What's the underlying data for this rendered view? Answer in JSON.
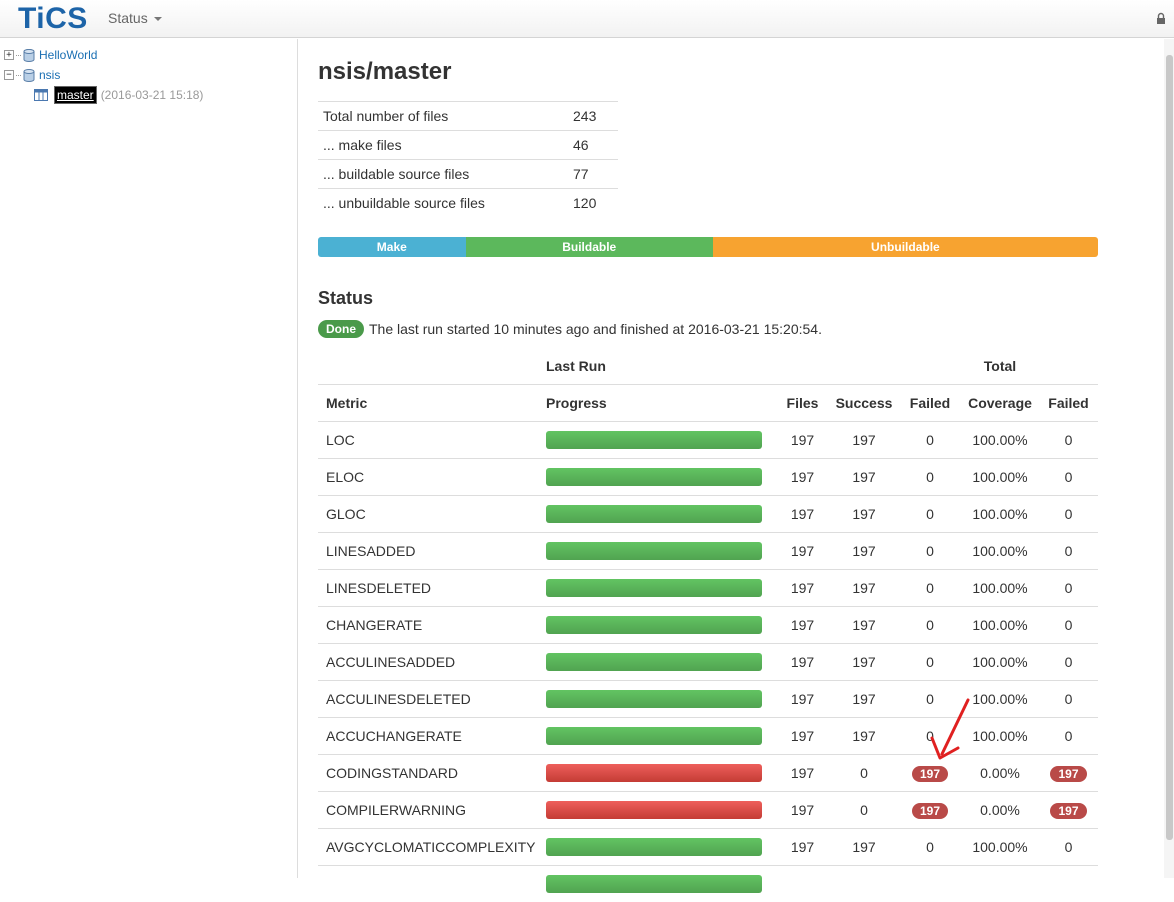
{
  "header": {
    "logo": "TiCS",
    "menu_label": "Status"
  },
  "tree": [
    {
      "label": "HelloWorld",
      "expander": "+"
    },
    {
      "label": "nsis",
      "expander": "−"
    },
    {
      "label": "master",
      "date": "(2016-03-21 15:18)"
    }
  ],
  "main": {
    "title": "nsis/master",
    "stats": [
      {
        "label": "Total number of files",
        "value": "243"
      },
      {
        "label": "... make files",
        "value": "46"
      },
      {
        "label": "... buildable source files",
        "value": "77"
      },
      {
        "label": "... unbuildable source files",
        "value": "120"
      }
    ],
    "filebar": [
      {
        "label": "Make",
        "count": 46,
        "color": "#4bb1d3"
      },
      {
        "label": "Buildable",
        "count": 77,
        "color": "#5cb85c"
      },
      {
        "label": "Unbuildable",
        "count": 120,
        "color": "#f7a330"
      }
    ],
    "status_heading": "Status",
    "status_badge": "Done",
    "status_text": "The last run started 10 minutes ago and finished at 2016-03-21 15:20:54.",
    "table": {
      "group_last_run": "Last Run",
      "group_total": "Total",
      "col_metric": "Metric",
      "col_progress": "Progress",
      "col_files": "Files",
      "col_success": "Success",
      "col_failed": "Failed",
      "col_coverage": "Coverage",
      "col_total_failed": "Failed",
      "rows": [
        {
          "metric": "LOC",
          "progress": 1.0,
          "status": "ok",
          "files": "197",
          "success": "197",
          "failed": "0",
          "coverage": "100.00%",
          "total_failed": "0"
        },
        {
          "metric": "ELOC",
          "progress": 1.0,
          "status": "ok",
          "files": "197",
          "success": "197",
          "failed": "0",
          "coverage": "100.00%",
          "total_failed": "0"
        },
        {
          "metric": "GLOC",
          "progress": 1.0,
          "status": "ok",
          "files": "197",
          "success": "197",
          "failed": "0",
          "coverage": "100.00%",
          "total_failed": "0"
        },
        {
          "metric": "LINESADDED",
          "progress": 1.0,
          "status": "ok",
          "files": "197",
          "success": "197",
          "failed": "0",
          "coverage": "100.00%",
          "total_failed": "0"
        },
        {
          "metric": "LINESDELETED",
          "progress": 1.0,
          "status": "ok",
          "files": "197",
          "success": "197",
          "failed": "0",
          "coverage": "100.00%",
          "total_failed": "0"
        },
        {
          "metric": "CHANGERATE",
          "progress": 1.0,
          "status": "ok",
          "files": "197",
          "success": "197",
          "failed": "0",
          "coverage": "100.00%",
          "total_failed": "0"
        },
        {
          "metric": "ACCULINESADDED",
          "progress": 1.0,
          "status": "ok",
          "files": "197",
          "success": "197",
          "failed": "0",
          "coverage": "100.00%",
          "total_failed": "0"
        },
        {
          "metric": "ACCULINESDELETED",
          "progress": 1.0,
          "status": "ok",
          "files": "197",
          "success": "197",
          "failed": "0",
          "coverage": "100.00%",
          "total_failed": "0"
        },
        {
          "metric": "ACCUCHANGERATE",
          "progress": 1.0,
          "status": "ok",
          "files": "197",
          "success": "197",
          "failed": "0",
          "coverage": "100.00%",
          "total_failed": "0"
        },
        {
          "metric": "CODINGSTANDARD",
          "progress": 1.0,
          "status": "bad",
          "files": "197",
          "success": "0",
          "failed": "197",
          "coverage": "0.00%",
          "total_failed": "197"
        },
        {
          "metric": "COMPILERWARNING",
          "progress": 1.0,
          "status": "bad",
          "files": "197",
          "success": "0",
          "failed": "197",
          "coverage": "0.00%",
          "total_failed": "197"
        },
        {
          "metric": "AVGCYCLOMATICCOMPLEXITY",
          "progress": 1.0,
          "status": "ok",
          "files": "197",
          "success": "197",
          "failed": "0",
          "coverage": "100.00%",
          "total_failed": "0"
        },
        {
          "metric": "",
          "progress": 1.0,
          "status": "ok",
          "files": "",
          "success": "",
          "failed": "",
          "coverage": "",
          "total_failed": ""
        }
      ]
    }
  },
  "colors": {
    "logo": "#1d64a8",
    "link": "#1a6fb3",
    "ok": "#5cb85c",
    "bad": "#d9534f",
    "badge": "#b94a48",
    "arrow": "#e02020"
  }
}
